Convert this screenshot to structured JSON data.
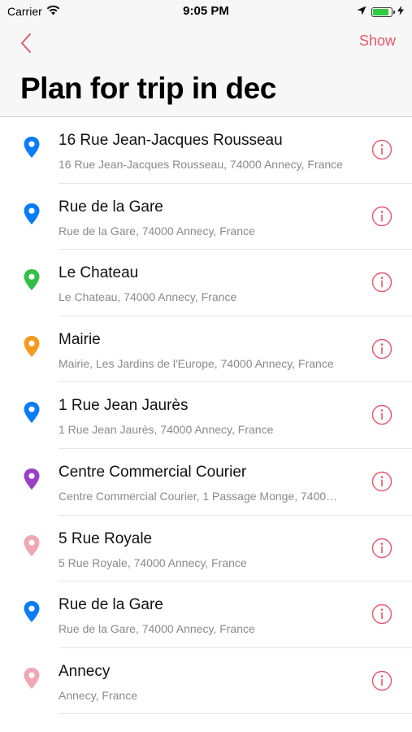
{
  "status_bar": {
    "carrier": "Carrier",
    "time": "9:05 PM",
    "battery_level": 0.9,
    "battery_color": "#2ecc40"
  },
  "nav": {
    "back_icon": "chevron-left-icon",
    "show_label": "Show",
    "accent_color": "#e8566b"
  },
  "page": {
    "title": "Plan for trip in dec"
  },
  "places": [
    {
      "title": "16 Rue Jean-Jacques Rousseau",
      "subtitle": "16 Rue Jean-Jacques Rousseau, 74000 Annecy, France",
      "pin_color": "#0a7cf8"
    },
    {
      "title": "Rue de la Gare",
      "subtitle": "Rue de la Gare, 74000 Annecy, France",
      "pin_color": "#0a7cf8"
    },
    {
      "title": "Le Chateau",
      "subtitle": "Le Chateau, 74000 Annecy, France",
      "pin_color": "#33bf47"
    },
    {
      "title": "Mairie",
      "subtitle": "Mairie, Les Jardins de l'Europe, 74000 Annecy, France",
      "pin_color": "#f59a1e"
    },
    {
      "title": "1 Rue Jean Jaurès",
      "subtitle": "1 Rue Jean Jaurès, 74000 Annecy, France",
      "pin_color": "#0a7cf8"
    },
    {
      "title": "Centre Commercial Courier",
      "subtitle": "Centre Commercial Courier, 1 Passage Monge, 7400…",
      "pin_color": "#9b3fc8"
    },
    {
      "title": "5 Rue Royale",
      "subtitle": "5 Rue Royale, 74000 Annecy, France",
      "pin_color": "#f0a6b3"
    },
    {
      "title": "Rue de la Gare",
      "subtitle": "Rue de la Gare, 74000 Annecy, France",
      "pin_color": "#0a7cf8"
    },
    {
      "title": "Annecy",
      "subtitle": "Annecy, France",
      "pin_color": "#f0a6b3"
    }
  ]
}
